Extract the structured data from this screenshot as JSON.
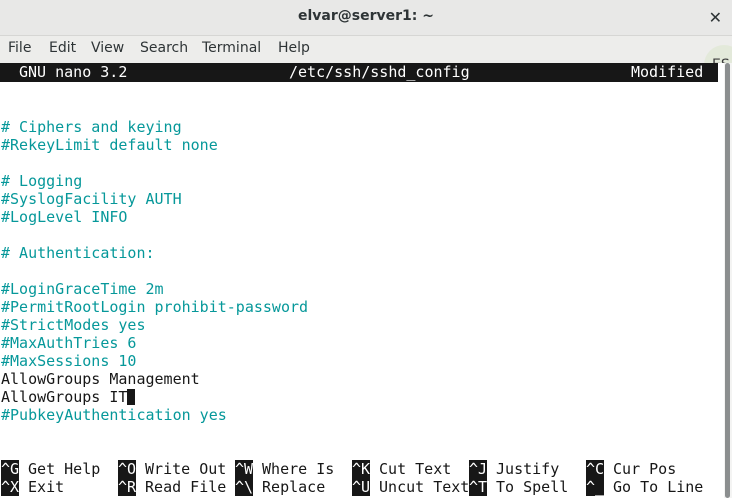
{
  "window": {
    "title": "elvar@server1: ~",
    "close_glyph": "✕"
  },
  "menu": [
    "File",
    "Edit",
    "View",
    "Search",
    "Terminal",
    "Help"
  ],
  "badge": "ES",
  "nano": {
    "version": "GNU nano 3.2",
    "filename": "/etc/ssh/sshd_config",
    "state": "Modified"
  },
  "lines": [
    {
      "text": "",
      "type": "plain"
    },
    {
      "text": "",
      "type": "plain"
    },
    {
      "text": "# Ciphers and keying",
      "type": "comment"
    },
    {
      "text": "#RekeyLimit default none",
      "type": "comment"
    },
    {
      "text": "",
      "type": "plain"
    },
    {
      "text": "# Logging",
      "type": "comment"
    },
    {
      "text": "#SyslogFacility AUTH",
      "type": "comment"
    },
    {
      "text": "#LogLevel INFO",
      "type": "comment"
    },
    {
      "text": "",
      "type": "plain"
    },
    {
      "text": "# Authentication:",
      "type": "comment"
    },
    {
      "text": "",
      "type": "plain"
    },
    {
      "text": "#LoginGraceTime 2m",
      "type": "comment"
    },
    {
      "text": "#PermitRootLogin prohibit-password",
      "type": "comment"
    },
    {
      "text": "#StrictModes yes",
      "type": "comment"
    },
    {
      "text": "#MaxAuthTries 6",
      "type": "comment"
    },
    {
      "text": "#MaxSessions 10",
      "type": "comment"
    },
    {
      "text": "AllowGroups Management",
      "type": "plain"
    },
    {
      "text": "AllowGroups IT",
      "type": "plain",
      "cursor": true
    },
    {
      "text": "#PubkeyAuthentication yes",
      "type": "comment"
    }
  ],
  "shortcuts": [
    [
      {
        "key": "^G",
        "label": "Get Help"
      },
      {
        "key": "^O",
        "label": "Write Out"
      },
      {
        "key": "^W",
        "label": "Where Is"
      },
      {
        "key": "^K",
        "label": "Cut Text"
      },
      {
        "key": "^J",
        "label": "Justify"
      },
      {
        "key": "^C",
        "label": "Cur Pos"
      }
    ],
    [
      {
        "key": "^X",
        "label": "Exit"
      },
      {
        "key": "^R",
        "label": "Read File"
      },
      {
        "key": "^\\",
        "label": "Replace"
      },
      {
        "key": "^U",
        "label": "Uncut Text"
      },
      {
        "key": "^T",
        "label": "To Spell"
      },
      {
        "key": "^_",
        "label": "Go To Line"
      }
    ]
  ],
  "colors": {
    "comment": "#06989a",
    "text": "#171717",
    "status_bg": "#171717"
  }
}
